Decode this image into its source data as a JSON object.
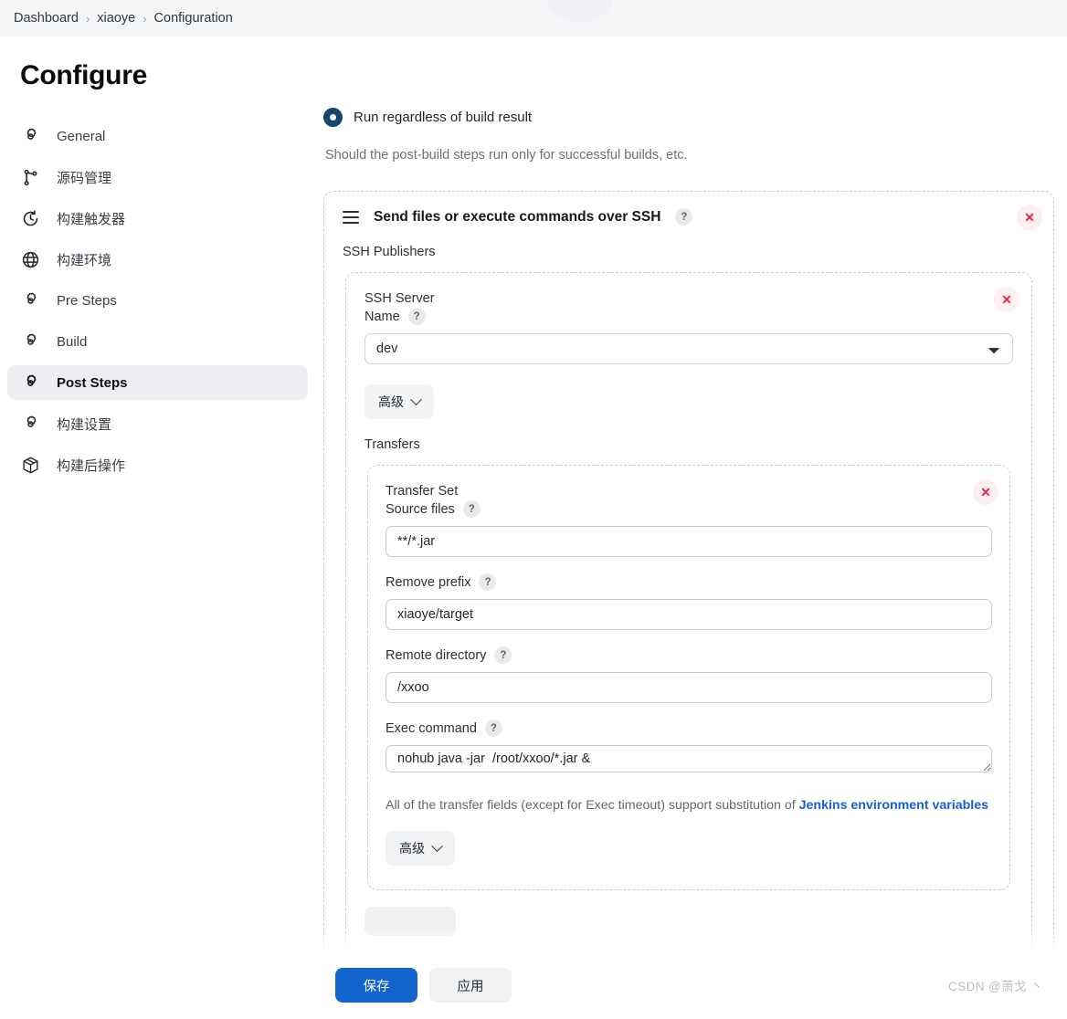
{
  "breadcrumb": {
    "items": [
      {
        "label": "Dashboard"
      },
      {
        "label": "xiaoye"
      },
      {
        "label": "Configuration"
      }
    ],
    "separator": "›"
  },
  "sidebar": {
    "title": "Configure",
    "items": [
      {
        "label": "General",
        "icon": "gear-icon",
        "active": false
      },
      {
        "label": "源码管理",
        "icon": "source-branch-icon",
        "active": false
      },
      {
        "label": "构建触发器",
        "icon": "clock-icon",
        "active": false
      },
      {
        "label": "构建环境",
        "icon": "globe-icon",
        "active": false
      },
      {
        "label": "Pre Steps",
        "icon": "gear-icon",
        "active": false
      },
      {
        "label": "Build",
        "icon": "gear-icon",
        "active": false
      },
      {
        "label": "Post Steps",
        "icon": "gear-icon",
        "active": true
      },
      {
        "label": "构建设置",
        "icon": "gear-icon",
        "active": false
      },
      {
        "label": "构建后操作",
        "icon": "package-icon",
        "active": false
      }
    ]
  },
  "main": {
    "radio_label": "Run regardless of build result",
    "hint": "Should the post-build steps run only for successful builds, etc.",
    "publisher": {
      "title": "Send files or execute commands over SSH",
      "help": "?",
      "delete": "✕",
      "section_label": "SSH Publishers",
      "server": {
        "group_name": "SSH Server",
        "name_label": "Name",
        "help": "?",
        "delete": "✕",
        "selected": "dev",
        "options": [
          "dev"
        ],
        "advanced_label": "高级",
        "transfers_label": "Transfers",
        "transfer_set": {
          "group_name": "Transfer Set",
          "delete": "✕",
          "fields": [
            {
              "label": "Source files",
              "help": "?",
              "value": "**/*.jar",
              "type": "input"
            },
            {
              "label": "Remove prefix",
              "help": "?",
              "value": "xiaoye/target",
              "type": "input"
            },
            {
              "label": "Remote directory",
              "help": "?",
              "value": "/xxoo",
              "type": "input"
            },
            {
              "label": "Exec command",
              "help": "?",
              "value": "nohub java -jar  /root/xxoo/*.jar &",
              "type": "textarea"
            }
          ],
          "note_prefix": "All of the transfer fields (except for Exec timeout) support substitution of ",
          "note_link": "Jenkins environment variables",
          "advanced_label": "高级"
        }
      }
    }
  },
  "footer": {
    "save_label": "保存",
    "apply_label": "应用",
    "watermark": "CSDN @萧戈 丶"
  },
  "colors": {
    "accent_blue": "#1364cc",
    "radio_navy": "#14466b",
    "delete_red": "#e0294a",
    "delete_bg": "#fdeef0",
    "link_blue": "#1560d8",
    "sidebar_active_bg": "#eceef1",
    "breadcrumb_bg": "#f4f5f7",
    "dashed_border": "#c8cdd2"
  }
}
